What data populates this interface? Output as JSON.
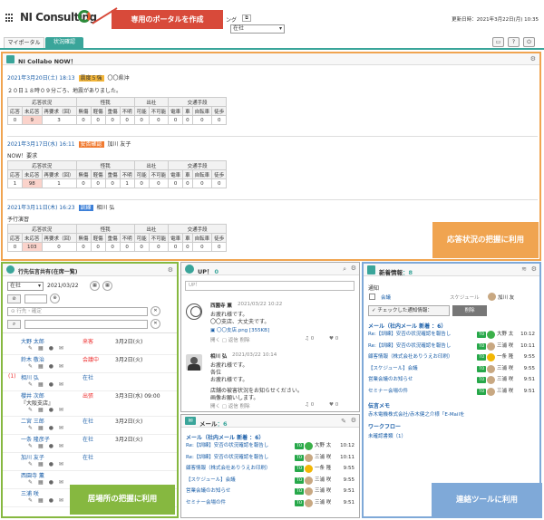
{
  "header": {
    "logo": "NI Consulting",
    "hidden_tab": "ング",
    "status": "在社",
    "updated": "更新日時：2021年3月22日(月) 10:35"
  },
  "callout": {
    "portal": "専用のポータルを作成",
    "response": "応答状況の把握に利用",
    "location": "居場所の把握に利用",
    "tools": "連絡ツールに利用"
  },
  "tabs": [
    {
      "label": "マイポータル"
    },
    {
      "label": "状況確認"
    }
  ],
  "collabo": {
    "title": "NI Collabo NOW！",
    "posts": [
      {
        "date": "2021年3月20日(土) 18:13",
        "badge": "震度５強",
        "badge_color": "#f3b63a",
        "author": "〇〇県沖",
        "body": "２０日１８時０９分ごろ、地震がありました。",
        "head1": [
          "応答状況",
          "怪我",
          "出社",
          "交通手段"
        ],
        "head2": [
          "応答",
          "未応答",
          "再要求（回）",
          "無傷",
          "軽傷",
          "重傷",
          "不明",
          "可能",
          "不可能",
          "電車",
          "車",
          "自転車",
          "徒歩"
        ],
        "values": [
          "0",
          "9",
          "3",
          "0",
          "0",
          "0",
          "0",
          "0",
          "0",
          "0",
          "0",
          "0",
          "0"
        ]
      },
      {
        "date": "2021年3月17日(水) 16:11",
        "badge": "安否確認",
        "badge_color": "#f07a30",
        "author": "加川 友子",
        "body": "NOW！要求",
        "head1": [
          "応答状況",
          "怪我",
          "出社",
          "交通手段"
        ],
        "head2": [
          "応答",
          "未応答",
          "再要求（回）",
          "無傷",
          "軽傷",
          "重傷",
          "不明",
          "可能",
          "不可能",
          "電車",
          "車",
          "自転車",
          "徒歩"
        ],
        "values": [
          "1",
          "98",
          "1",
          "0",
          "0",
          "0",
          "1",
          "0",
          "0",
          "0",
          "0",
          "0",
          "0"
        ]
      },
      {
        "date": "2021年3月11日(木) 16:23",
        "badge": "訓練",
        "badge_color": "#3b7fd8",
        "author": "相川 弘",
        "body": "予行演習",
        "head1": [
          "応答状況",
          "怪我",
          "出社",
          "交通手段"
        ],
        "head2": [
          "応答",
          "未応答",
          "再要求（回）",
          "無傷",
          "軽傷",
          "重傷",
          "不明",
          "可能",
          "不可能",
          "電車",
          "車",
          "自転車",
          "徒歩"
        ],
        "values": [
          "0",
          "103",
          "0",
          "0",
          "0",
          "0",
          "0",
          "0",
          "0",
          "0",
          "0",
          "0",
          "0"
        ]
      }
    ]
  },
  "dengon": {
    "title": "行先伝言共有(在席一覧)",
    "filter_status": "在社",
    "date": "2021/03/22",
    "place_placeholder": "行先・確定",
    "people": [
      {
        "name": "大野 太郎",
        "status": "来客",
        "date": "3月2日(火)",
        "status_color": "#e33"
      },
      {
        "name": "鈴木 敬治",
        "status": "会議中",
        "date": "3月2日(火)",
        "status_color": "#e33"
      },
      {
        "prefix": "(1)",
        "name": "相川 弘",
        "status": "在社",
        "date": "",
        "status_color": "#1a5ea8"
      },
      {
        "name": "櫻井 次郎",
        "status": "出張",
        "date": "3月3日(水) 09:00",
        "status_color": "#e33",
        "sub": "『大阪支店』"
      },
      {
        "name": "二宮 三郎",
        "status": "在社",
        "date": "3月2日(火)",
        "status_color": "#1a5ea8"
      },
      {
        "name": "一条 隆彦子",
        "status": "在社",
        "date": "3月2日(火)",
        "status_color": "#1a5ea8"
      },
      {
        "name": "加川 友子",
        "status": "在社",
        "date": "",
        "status_color": "#1a5ea8"
      },
      {
        "name": "西園寺 薫",
        "status": "",
        "date": "",
        "status_color": "#1a5ea8"
      },
      {
        "name": "三浦 咲",
        "status": "",
        "date": "",
        "status_color": "#1a5ea8"
      }
    ]
  },
  "up": {
    "title": "UP！",
    "count": "0",
    "placeholder": "UP！",
    "posts": [
      {
        "name": "西園寺 薫",
        "time": "2021/03/22 10:22",
        "lines": [
          "お疲れ様です。",
          "〇〇支店、大丈夫です。"
        ],
        "attach": "〇〇支店.png [355KB]",
        "actions": "開く ▢ 返信 削除",
        "likes": "0",
        "hearts": "0"
      },
      {
        "name": "相川 弘",
        "time": "2021/03/22 10:14",
        "lines": [
          "お疲れ様です。",
          "各位",
          "お疲れ様です。",
          "",
          "店舗の被害状況をお知らせください。",
          "画像お願いします。"
        ],
        "actions": "開く ▢ 返信 削除",
        "likes": "0",
        "hearts": "0"
      }
    ]
  },
  "mail": {
    "title": "メール",
    "count": "6",
    "subhead": "メール（社内メール 新着 ：6）",
    "rows": [
      {
        "subject": "Re:【訓練】安否の状況確認を報告し",
        "to": "TO",
        "name": "大野 太",
        "time": "10:12",
        "color": "#3cb04a"
      },
      {
        "subject": "Re:【訓練】安否の状況確認を報告し",
        "to": "TO",
        "name": "三浦 咲",
        "time": "10:11",
        "color": "#c8a882"
      },
      {
        "subject": "顧客情報（株式会社ありうえお印刷）",
        "to": "TO",
        "name": "一条 隆",
        "time": "9:55",
        "color": "#f2b705"
      },
      {
        "subject": "【スケジュール】会議",
        "to": "TO",
        "name": "三浦 咲",
        "time": "9:55",
        "color": "#c8a882"
      },
      {
        "subject": "営業会議のお知らせ",
        "to": "TO",
        "name": "三浦 咲",
        "time": "9:51",
        "color": "#c8a882"
      },
      {
        "subject": "セミナー会場の件",
        "to": "TO",
        "name": "三浦 咲",
        "time": "9:51",
        "color": "#c8a882"
      }
    ]
  },
  "news": {
    "title": "新着情報",
    "count": "8",
    "notice": "通知",
    "meeting": "会議",
    "schedule": "スケジュール",
    "meeting_user": "加川 友",
    "checked_btn": "チェックした通知情報：",
    "delete_btn": "削除",
    "mail_head": "メール（社内メール 新着 ：6）",
    "rows": [
      {
        "subject": "Re:【訓練】安否の状況確認を報告し",
        "to": "TO",
        "name": "大野 太",
        "time": "10:12",
        "color": "#3cb04a"
      },
      {
        "subject": "Re:【訓練】安否の状況確認を報告し",
        "to": "TO",
        "name": "三浦 咲",
        "time": "10:11",
        "color": "#c8a882"
      },
      {
        "subject": "顧客情報（株式会社ありうえお印刷）",
        "to": "TO",
        "name": "一条 隆",
        "time": "9:55",
        "color": "#f2b705"
      },
      {
        "subject": "【スケジュール】会議",
        "to": "TO",
        "name": "三浦 咲",
        "time": "9:55",
        "color": "#c8a882"
      },
      {
        "subject": "営業会議のお知らせ",
        "to": "TO",
        "name": "三浦 咲",
        "time": "9:51",
        "color": "#c8a882"
      },
      {
        "subject": "セミナー会場の件",
        "to": "TO",
        "name": "三浦 咲",
        "time": "9:51",
        "color": "#c8a882"
      }
    ],
    "memo_head": "伝言メモ",
    "memo_text": "赤木電機株式会社/赤木健之介様「E-Mailを",
    "wf_head": "ワークフロー",
    "wf_text": "未確認書類（1）"
  },
  "icons": {
    "grid": "grid-icon",
    "gear": "gear-icon",
    "book": "book-icon",
    "help": "help-icon",
    "power": "power-icon"
  },
  "colors": {
    "orange": "#f0a450",
    "green": "#86b840",
    "blue": "#7fa9d8",
    "red_banner": "#d84a3a",
    "teal": "#3aa59a"
  }
}
